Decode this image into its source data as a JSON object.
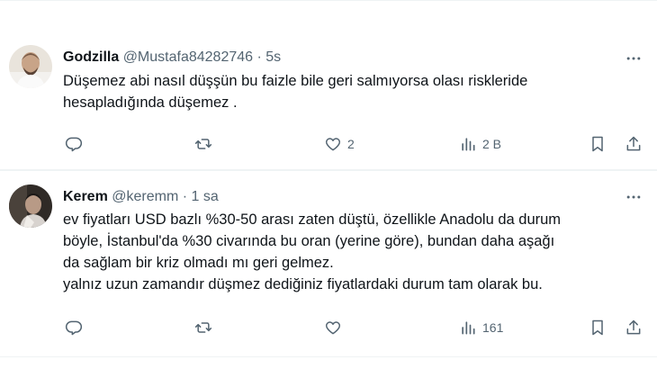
{
  "tweets": [
    {
      "name": "Godzilla",
      "handle": "@Mustafa84282746",
      "separator": "·",
      "time": "5s",
      "lines": [
        "Düşemez abi nasıl düşşün bu faizle bile geri salmıyorsa olası riskleride",
        "hesapladığında düşemez ."
      ],
      "actions": {
        "reply_count": "",
        "retweet_count": "",
        "like_count": "2",
        "view_count": "2 B"
      }
    },
    {
      "name": "Kerem",
      "handle": "@keremm",
      "separator": "·",
      "time": "1 sa",
      "lines": [
        "ev fiyatları USD bazlı %30-50 arası zaten düştü, özellikle Anadolu da durum",
        "böyle, İstanbul'da %30 civarında bu oran (yerine göre), bundan daha aşağı",
        "da sağlam bir kriz olmadı mı geri gelmez.",
        "yalnız uzun zamandır düşmez dediğiniz fiyatlardaki durum tam olarak bu."
      ],
      "actions": {
        "reply_count": "",
        "retweet_count": "",
        "like_count": "",
        "view_count": "161"
      }
    }
  ],
  "icons": {
    "more": "more-horizontal-icon",
    "reply": "reply-icon",
    "retweet": "retweet-icon",
    "like": "like-icon",
    "views": "views-icon",
    "bookmark": "bookmark-icon",
    "share": "share-icon"
  },
  "colors": {
    "text": "#0f1419",
    "secondary": "#536471",
    "divider": "#eff3f4"
  }
}
